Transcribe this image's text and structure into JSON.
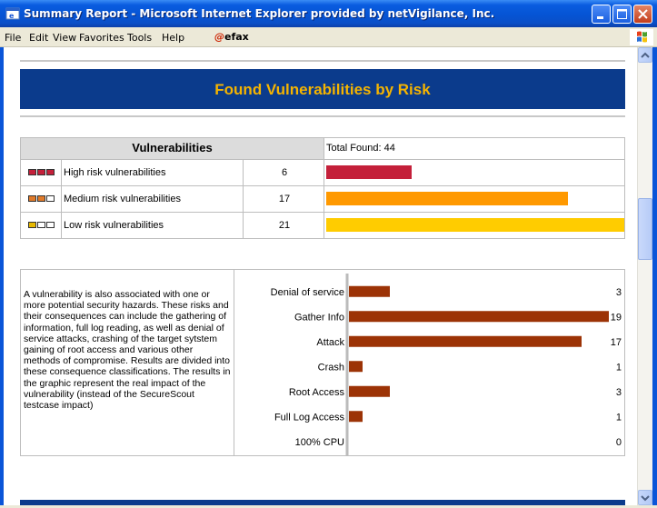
{
  "window": {
    "title": "Summary Report - Microsoft Internet Explorer provided by netVigilance, Inc."
  },
  "menu": {
    "items": [
      "File",
      "Edit",
      "View",
      "Favorites",
      "Tools",
      "Help"
    ],
    "efax_label": "efax"
  },
  "report": {
    "banner_title": "Found Vulnerabilities by Risk",
    "vuln_header": "Vulnerabilities",
    "total_found": "Total Found: 44",
    "rows": [
      {
        "label": "High risk vulnerabilities",
        "count": "6",
        "value": 6,
        "color": "#c4203a",
        "icon": "high-risk-icon"
      },
      {
        "label": "Medium risk vulnerabilities",
        "count": "17",
        "value": 17,
        "color": "#ff9900",
        "icon": "medium-risk-icon"
      },
      {
        "label": "Low risk vulnerabilities",
        "count": "21",
        "value": 21,
        "color": "#ffcc00",
        "icon": "low-risk-icon"
      }
    ],
    "description": "A vulnerability is also associated with one or more potential security hazards. These risks and their consequences can include the gathering of information, full log reading, as well as denial of service attacks, crashing of the target sytstem gaining of root access and various other methods of compromise. Results are divided into these consequence classifications. The results in the graphic represent the real impact of the vulnerability (instead of the SecureScout testcase impact)"
  },
  "chart_data": {
    "type": "bar",
    "orientation": "horizontal",
    "categories": [
      "Denial of service",
      "Gather Info",
      "Attack",
      "Crash",
      "Root Access",
      "Full Log Access",
      "100% CPU"
    ],
    "values": [
      3,
      19,
      17,
      1,
      3,
      1,
      0
    ],
    "xlim": [
      0,
      19
    ],
    "bar_color": "#9c3306",
    "grid": false
  }
}
